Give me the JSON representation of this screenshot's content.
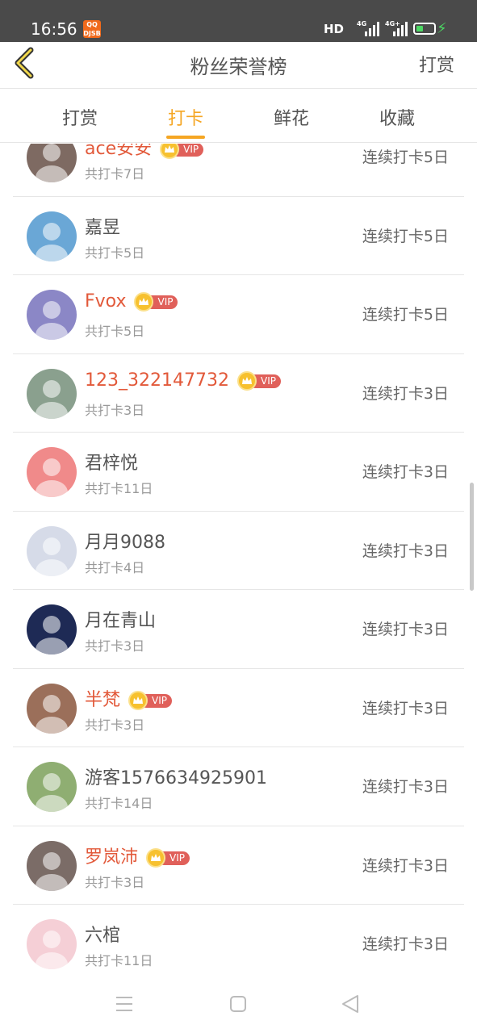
{
  "status_bar": {
    "time": "16:56",
    "app_icon": "QQ DJSB",
    "hd_label": "HD",
    "network_1": "4G",
    "network_2": "4G+",
    "icons": [
      "app-notification-icon",
      "signal-icon",
      "battery-icon",
      "charging-icon"
    ]
  },
  "header": {
    "title": "粉丝荣誉榜",
    "action_label": "打赏",
    "back_icon": "chevron-left-icon"
  },
  "tabs": [
    {
      "label": "打赏",
      "active": false
    },
    {
      "label": "打卡",
      "active": true
    },
    {
      "label": "鲜花",
      "active": false
    },
    {
      "label": "收藏",
      "active": false
    }
  ],
  "fans": [
    {
      "name": "ace安安",
      "vip": true,
      "total": "共打卡7日",
      "streak": "连续打卡5日",
      "avatar_color": "#7e6a62"
    },
    {
      "name": "嘉昱",
      "vip": false,
      "total": "共打卡5日",
      "streak": "连续打卡5日",
      "avatar_color": "#6aa7d6"
    },
    {
      "name": "Fvox",
      "vip": true,
      "total": "共打卡5日",
      "streak": "连续打卡5日",
      "avatar_color": "#8b87c6"
    },
    {
      "name": "123_322147732",
      "vip": true,
      "total": "共打卡3日",
      "streak": "连续打卡3日",
      "avatar_color": "#8aa08e"
    },
    {
      "name": "君梓悦",
      "vip": false,
      "total": "共打卡11日",
      "streak": "连续打卡3日",
      "avatar_color": "#f08a8a"
    },
    {
      "name": "月月9088",
      "vip": false,
      "total": "共打卡4日",
      "streak": "连续打卡3日",
      "avatar_color": "#d6dbe8"
    },
    {
      "name": "月在青山",
      "vip": false,
      "total": "共打卡3日",
      "streak": "连续打卡3日",
      "avatar_color": "#1e2a55"
    },
    {
      "name": "半梵",
      "vip": true,
      "total": "共打卡3日",
      "streak": "连续打卡3日",
      "avatar_color": "#9b6f5a"
    },
    {
      "name": "游客1576634925901",
      "vip": false,
      "total": "共打卡14日",
      "streak": "连续打卡3日",
      "avatar_color": "#8fae72"
    },
    {
      "name": "罗岚沛",
      "vip": true,
      "total": "共打卡3日",
      "streak": "连续打卡3日",
      "avatar_color": "#7b6c67"
    },
    {
      "name": "六棺",
      "vip": false,
      "total": "共打卡11日",
      "streak": "连续打卡3日",
      "avatar_color": "#f5cfd6"
    }
  ],
  "vip_label": "VIP",
  "nav": {
    "icons": [
      "menu-icon",
      "home-square-icon",
      "back-triangle-icon"
    ]
  }
}
